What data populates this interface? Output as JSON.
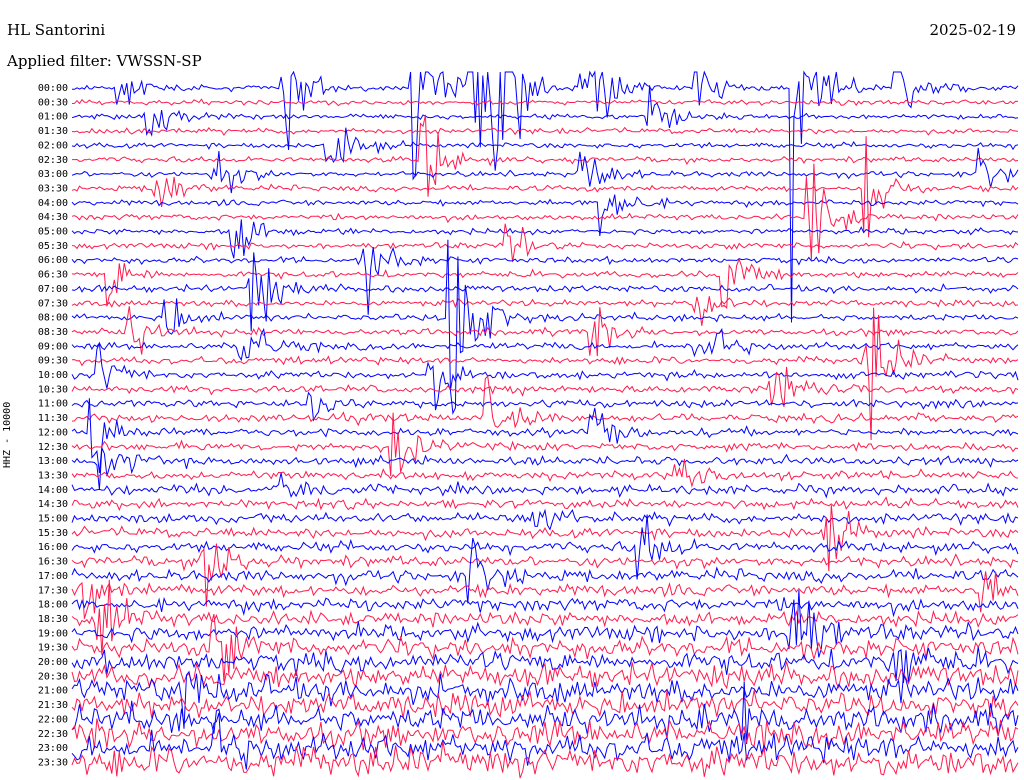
{
  "header": {
    "station": "HL Santorini",
    "date": "2025-02-19",
    "filter": "Applied filter: VWSSN-SP"
  },
  "chart_data": {
    "type": "line",
    "title": "HL Santorini",
    "channel_label": "HHZ - 10000",
    "trace_colors": [
      "#0000ff",
      "#ff1a4d"
    ],
    "row_labels": [
      "00:00",
      "00:30",
      "01:00",
      "01:30",
      "02:00",
      "02:30",
      "03:00",
      "03:30",
      "04:00",
      "04:30",
      "05:00",
      "05:30",
      "06:00",
      "06:30",
      "07:00",
      "07:30",
      "08:00",
      "08:30",
      "09:00",
      "09:30",
      "10:00",
      "10:30",
      "11:00",
      "11:30",
      "12:00",
      "12:30",
      "13:00",
      "13:30",
      "14:00",
      "14:30",
      "15:00",
      "15:30",
      "16:00",
      "16:30",
      "17:00",
      "17:30",
      "18:00",
      "18:30",
      "19:00",
      "19:30",
      "20:00",
      "20:30",
      "21:00",
      "21:30",
      "22:00",
      "22:30",
      "23:00",
      "23:30"
    ],
    "ylim": [
      "00:00",
      "23:30"
    ],
    "row_noise_level": [
      0.15,
      0.15,
      0.16,
      0.16,
      0.16,
      0.17,
      0.17,
      0.17,
      0.18,
      0.18,
      0.18,
      0.19,
      0.19,
      0.2,
      0.2,
      0.2,
      0.21,
      0.21,
      0.22,
      0.22,
      0.22,
      0.23,
      0.23,
      0.24,
      0.24,
      0.25,
      0.25,
      0.26,
      0.27,
      0.28,
      0.29,
      0.3,
      0.31,
      0.33,
      0.35,
      0.37,
      0.4,
      0.44,
      0.5,
      0.56,
      0.62,
      0.68,
      0.72,
      0.75,
      0.78,
      0.8,
      0.82,
      0.85
    ],
    "events": [
      {
        "row": 0,
        "position": 0.05,
        "amplitude": 1.5
      },
      {
        "row": 0,
        "position": 0.22,
        "amplitude": 6
      },
      {
        "row": 0,
        "position": 0.36,
        "amplitude": 8
      },
      {
        "row": 0,
        "position": 0.42,
        "amplitude": 12
      },
      {
        "row": 0,
        "position": 0.45,
        "amplitude": 9
      },
      {
        "row": 0,
        "position": 0.54,
        "amplitude": 7
      },
      {
        "row": 0,
        "position": 0.66,
        "amplitude": 3
      },
      {
        "row": 0,
        "position": 0.76,
        "amplitude": 12
      },
      {
        "row": 0,
        "position": 0.87,
        "amplitude": 5
      },
      {
        "row": 2,
        "position": 0.08,
        "amplitude": 2
      },
      {
        "row": 2,
        "position": 0.61,
        "amplitude": 3
      },
      {
        "row": 4,
        "position": 0.27,
        "amplitude": 3
      },
      {
        "row": 5,
        "position": 0.37,
        "amplitude": 4
      },
      {
        "row": 6,
        "position": 0.15,
        "amplitude": 2.5
      },
      {
        "row": 6,
        "position": 0.54,
        "amplitude": 2.5
      },
      {
        "row": 6,
        "position": 0.96,
        "amplitude": 2
      },
      {
        "row": 7,
        "position": 0.09,
        "amplitude": 2.5
      },
      {
        "row": 7,
        "position": 0.84,
        "amplitude": 4
      },
      {
        "row": 8,
        "position": 0.56,
        "amplitude": 4
      },
      {
        "row": 9,
        "position": 0.78,
        "amplitude": 5
      },
      {
        "row": 10,
        "position": 0.17,
        "amplitude": 3
      },
      {
        "row": 11,
        "position": 0.46,
        "amplitude": 2
      },
      {
        "row": 12,
        "position": 0.31,
        "amplitude": 3
      },
      {
        "row": 13,
        "position": 0.04,
        "amplitude": 2
      },
      {
        "row": 13,
        "position": 0.69,
        "amplitude": 3
      },
      {
        "row": 14,
        "position": 0.19,
        "amplitude": 4
      },
      {
        "row": 15,
        "position": 0.66,
        "amplitude": 2
      },
      {
        "row": 16,
        "position": 0.4,
        "amplitude": 13
      },
      {
        "row": 16,
        "position": 0.1,
        "amplitude": 2
      },
      {
        "row": 17,
        "position": 0.06,
        "amplitude": 2.5
      },
      {
        "row": 17,
        "position": 0.55,
        "amplitude": 2
      },
      {
        "row": 18,
        "position": 0.18,
        "amplitude": 3
      },
      {
        "row": 18,
        "position": 0.66,
        "amplitude": 4
      },
      {
        "row": 19,
        "position": 0.84,
        "amplitude": 6
      },
      {
        "row": 20,
        "position": 0.38,
        "amplitude": 3
      },
      {
        "row": 20,
        "position": 0.03,
        "amplitude": 2
      },
      {
        "row": 21,
        "position": 0.74,
        "amplitude": 3
      },
      {
        "row": 22,
        "position": 0.25,
        "amplitude": 3
      },
      {
        "row": 23,
        "position": 0.44,
        "amplitude": 2.5
      },
      {
        "row": 24,
        "position": 0.02,
        "amplitude": 3
      },
      {
        "row": 24,
        "position": 0.55,
        "amplitude": 2
      },
      {
        "row": 25,
        "position": 0.34,
        "amplitude": 3
      },
      {
        "row": 26,
        "position": 0.03,
        "amplitude": 2
      },
      {
        "row": 27,
        "position": 0.64,
        "amplitude": 2
      },
      {
        "row": 28,
        "position": 0.22,
        "amplitude": 3
      },
      {
        "row": 30,
        "position": 0.49,
        "amplitude": 2
      },
      {
        "row": 31,
        "position": 0.8,
        "amplitude": 2.5
      },
      {
        "row": 32,
        "position": 0.6,
        "amplitude": 3
      },
      {
        "row": 33,
        "position": 0.14,
        "amplitude": 4
      },
      {
        "row": 34,
        "position": 0.42,
        "amplitude": 3
      },
      {
        "row": 35,
        "position": 0.01,
        "amplitude": 2
      },
      {
        "row": 35,
        "position": 0.96,
        "amplitude": 2
      },
      {
        "row": 37,
        "position": 0.03,
        "amplitude": 3
      },
      {
        "row": 38,
        "position": 0.76,
        "amplitude": 7
      },
      {
        "row": 39,
        "position": 0.15,
        "amplitude": 3
      },
      {
        "row": 40,
        "position": 0.87,
        "amplitude": 2.5
      },
      {
        "row": 42,
        "position": 0.12,
        "amplitude": 2
      },
      {
        "row": 44,
        "position": 0.71,
        "amplitude": 2
      },
      {
        "row": 46,
        "position": 0.15,
        "amplitude": 2
      }
    ]
  }
}
